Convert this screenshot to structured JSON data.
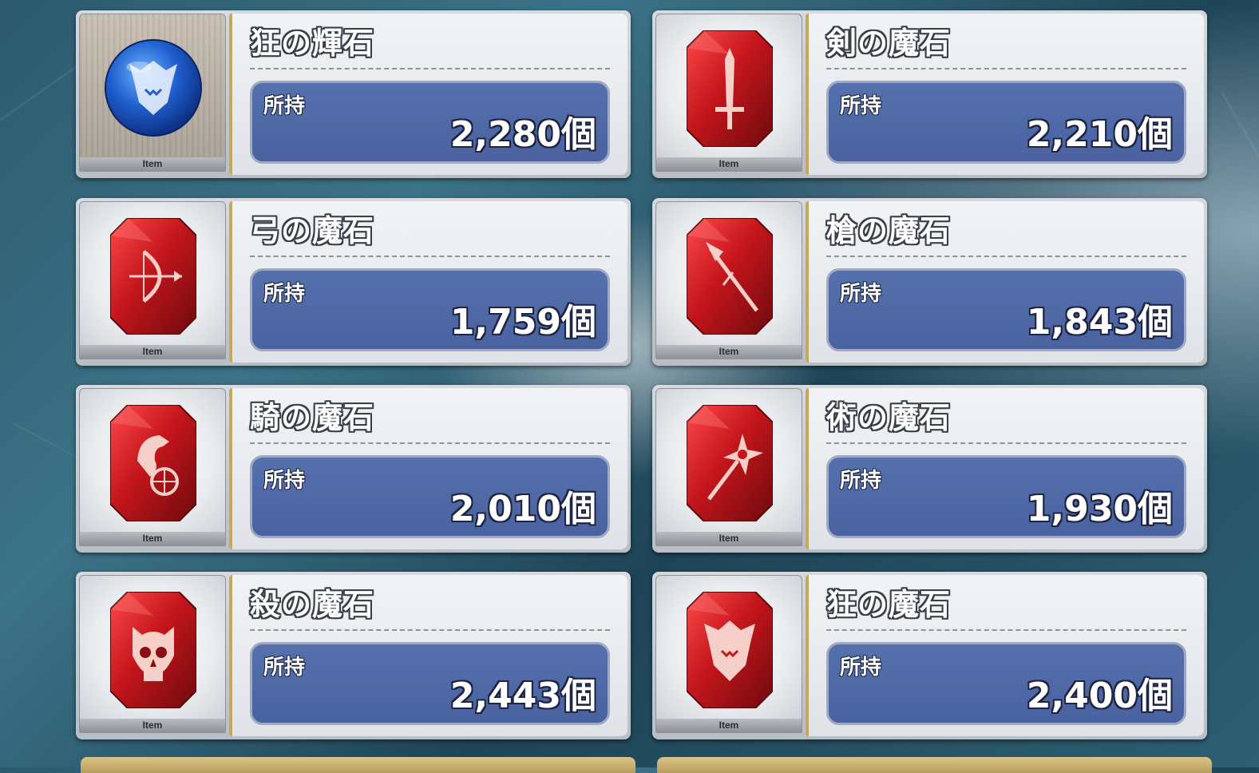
{
  "owned_label": "所持",
  "thumb_label": "Item",
  "items": [
    {
      "name": "狂の輝石",
      "count": "2,280個",
      "icon": "berserker-dragon-orb-icon",
      "color": "blue"
    },
    {
      "name": "剣の魔石",
      "count": "2,210個",
      "icon": "saber-sword-gem-icon",
      "color": "red"
    },
    {
      "name": "弓の魔石",
      "count": "1,759個",
      "icon": "archer-bow-gem-icon",
      "color": "red"
    },
    {
      "name": "槍の魔石",
      "count": "1,843個",
      "icon": "lancer-spear-gem-icon",
      "color": "red"
    },
    {
      "name": "騎の魔石",
      "count": "2,010個",
      "icon": "rider-horse-gem-icon",
      "color": "red"
    },
    {
      "name": "術の魔石",
      "count": "1,930個",
      "icon": "caster-staff-gem-icon",
      "color": "red"
    },
    {
      "name": "殺の魔石",
      "count": "2,443個",
      "icon": "assassin-skull-gem-icon",
      "color": "red"
    },
    {
      "name": "狂の魔石",
      "count": "2,400個",
      "icon": "berserker-dragon-gem-icon",
      "color": "red"
    }
  ],
  "colors": {
    "count_panel": "#4f68a5",
    "gem_red": "#c0191e",
    "orb_blue": "#1f5fcf",
    "frame_gold": "#c6a85a"
  }
}
